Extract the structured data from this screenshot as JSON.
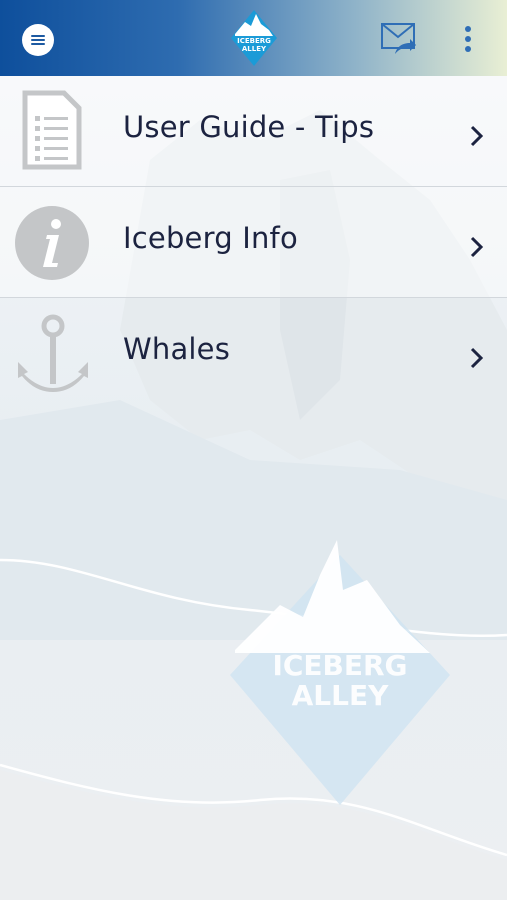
{
  "app": {
    "logo_text_line1": "ICEBERG",
    "logo_text_line2": "ALLEY"
  },
  "header": {
    "menu_icon": "hamburger-icon",
    "mail_icon": "mail-share-icon",
    "more_icon": "more-vert-icon"
  },
  "menu": {
    "items": [
      {
        "label": "User Guide - Tips",
        "icon": "document-list-icon"
      },
      {
        "label": "Iceberg Info",
        "icon": "info-circle-icon"
      },
      {
        "label": "Whales",
        "icon": "anchor-icon"
      }
    ]
  },
  "colors": {
    "brand_blue": "#0e4f9c",
    "text": "#1c2340",
    "icon_gray": "#c4c6c8"
  }
}
